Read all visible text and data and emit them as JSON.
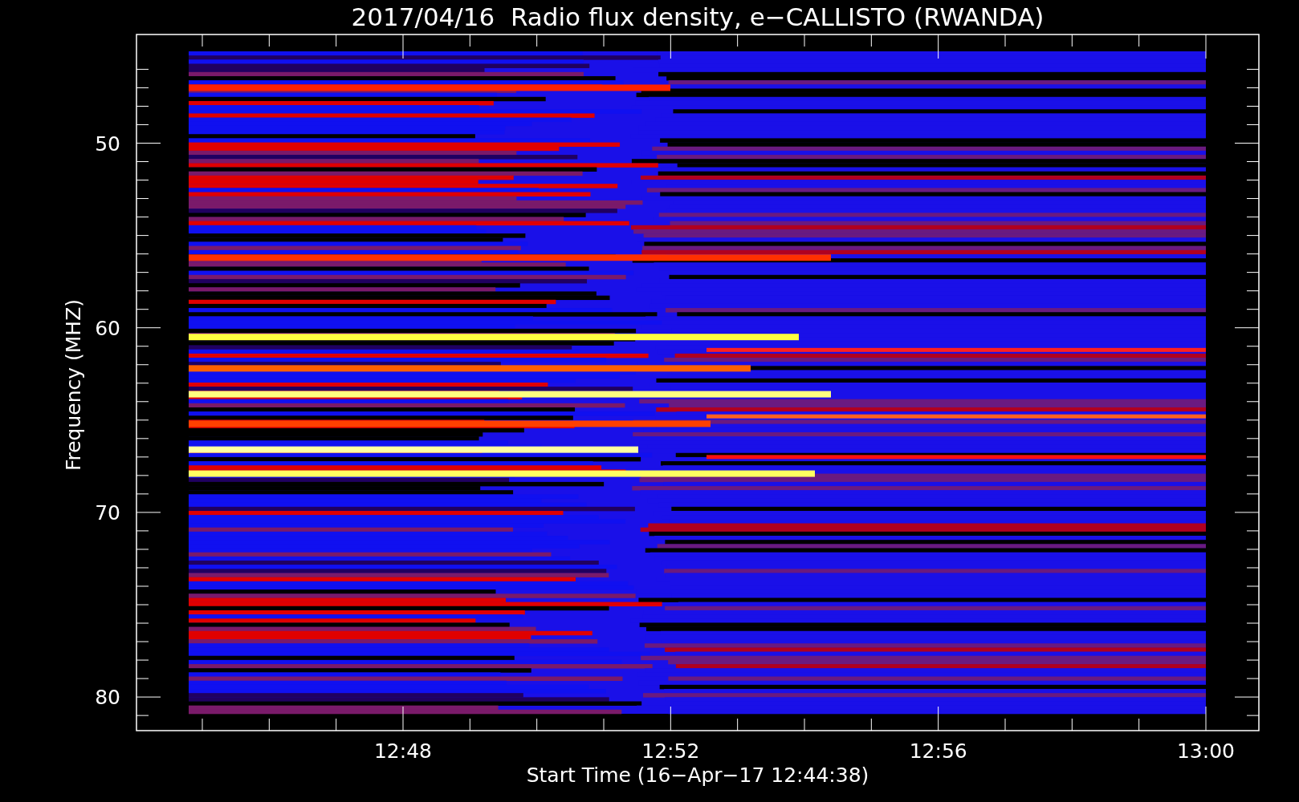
{
  "title": "2017/04/16  Radio flux density, e−CALLISTO (RWANDA)",
  "y_axis": {
    "label": "Frequency (MHZ)",
    "ticks": [
      "50",
      "60",
      "70",
      "80"
    ]
  },
  "x_axis": {
    "label": "Start Time (16−Apr−17 12:44:38)",
    "ticks": [
      "12:48",
      "12:52",
      "12:56",
      "13:00"
    ]
  }
}
